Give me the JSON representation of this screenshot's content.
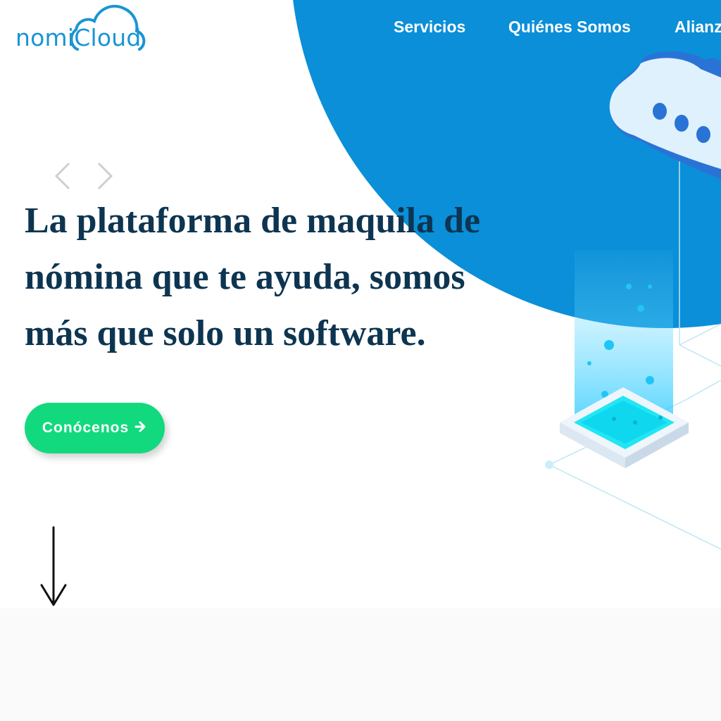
{
  "brand": {
    "logo_prefix": "nomi",
    "logo_cloud_word": "Cloud",
    "primary_color": "#0a8fd8",
    "logo_color": "#1a95d4",
    "headline_color": "#0d3551",
    "cta_color": "#13d97e"
  },
  "nav": {
    "items": [
      {
        "label": "Servicios"
      },
      {
        "label": "Quiénes Somos"
      },
      {
        "label": "Alianz"
      }
    ]
  },
  "carousel": {
    "prev_icon": "chevron-left-icon",
    "next_icon": "chevron-right-icon"
  },
  "hero": {
    "headline": "La plataforma de maquila de nómina que te ayuda, somos más que solo un software.",
    "cta_label": "Conócenos",
    "cta_icon": "arrow-right-icon"
  },
  "scroll_indicator": {
    "icon": "arrow-down-icon"
  }
}
